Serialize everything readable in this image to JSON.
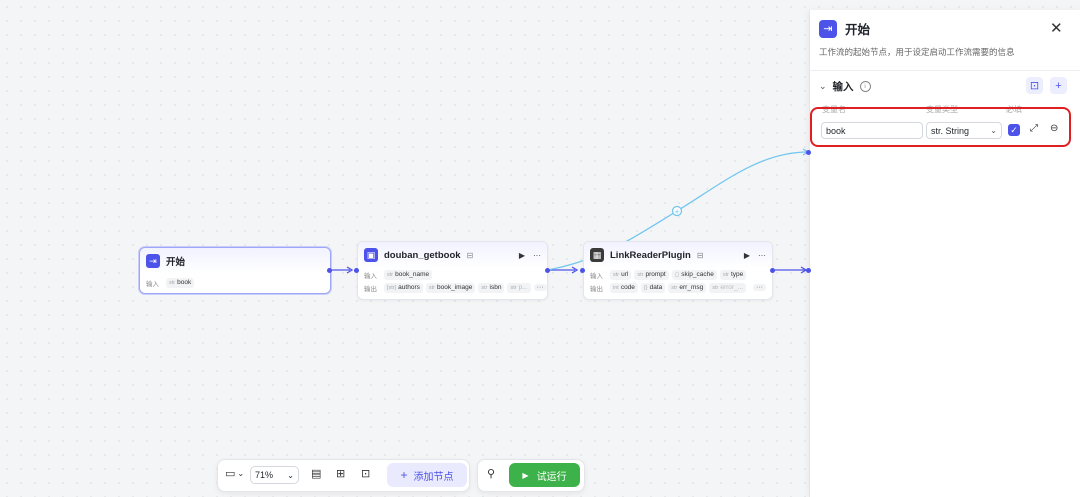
{
  "panel": {
    "title": "开始",
    "description": "工作流的起始节点，用于设定启动工作流需要的信息",
    "section_title": "输入",
    "col_var_name": "变量名",
    "col_var_type": "变量类型",
    "col_required": "必填",
    "var_name_value": "book",
    "var_type_value": "str. String",
    "required_checked": true
  },
  "nodes": {
    "start": {
      "title": "开始",
      "input_label": "输入",
      "inputs": [
        {
          "type": "str",
          "name": "book"
        }
      ]
    },
    "douban": {
      "title": "douban_getbook",
      "input_label": "输入",
      "output_label": "输出",
      "inputs": [
        {
          "type": "str",
          "name": "book_name"
        }
      ],
      "outputs": [
        {
          "type": "[str]",
          "name": "authors"
        },
        {
          "type": "str",
          "name": "book_image"
        },
        {
          "type": "str",
          "name": "isbn"
        },
        {
          "type": "str",
          "name": "p..."
        }
      ]
    },
    "linkreader": {
      "title": "LinkReaderPlugin",
      "input_label": "输入",
      "output_label": "输出",
      "inputs": [
        {
          "type": "str",
          "name": "url"
        },
        {
          "type": "str",
          "name": "prompt"
        },
        {
          "type": "",
          "name": "skip_cache"
        },
        {
          "type": "str",
          "name": "type"
        }
      ],
      "outputs": [
        {
          "type": "int",
          "name": "code"
        },
        {
          "type": "{}",
          "name": "data"
        },
        {
          "type": "str",
          "name": "err_msg"
        },
        {
          "type": "str",
          "name": "error_..."
        }
      ]
    }
  },
  "toolbar": {
    "zoom": "71%",
    "add_node": "添加节点",
    "run": "试运行"
  },
  "colors": {
    "accent": "#4d53e8",
    "run": "#3eb24a",
    "edge": "#4d53e8",
    "edge_light": "#73c6f0",
    "highlight": "#e02020"
  }
}
